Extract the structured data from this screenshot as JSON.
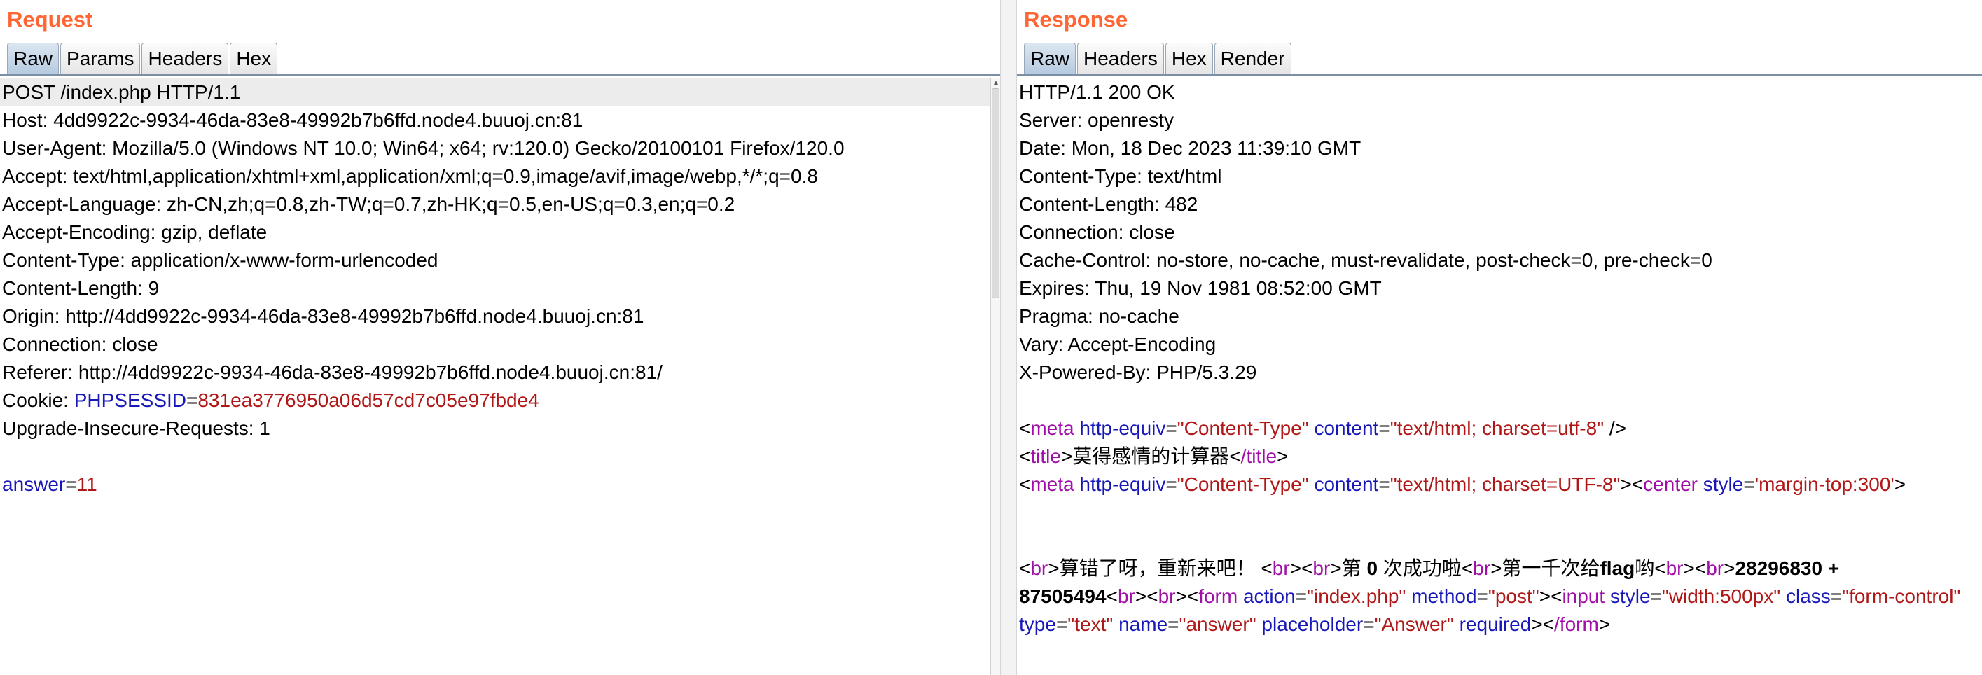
{
  "request": {
    "title": "Request",
    "tabs": [
      "Raw",
      "Params",
      "Headers",
      "Hex"
    ],
    "active_tab": "Raw",
    "lines": {
      "l1": "POST /index.php HTTP/1.1",
      "l2": "Host: 4dd9922c-9934-46da-83e8-49992b7b6ffd.node4.buuoj.cn:81",
      "l3": "User-Agent: Mozilla/5.0 (Windows NT 10.0; Win64; x64; rv:120.0) Gecko/20100101 Firefox/120.0",
      "l4": "Accept: text/html,application/xhtml+xml,application/xml;q=0.9,image/avif,image/webp,*/*;q=0.8",
      "l5": "Accept-Language: zh-CN,zh;q=0.8,zh-TW;q=0.7,zh-HK;q=0.5,en-US;q=0.3,en;q=0.2",
      "l6": "Accept-Encoding: gzip, deflate",
      "l7": "Content-Type: application/x-www-form-urlencoded",
      "l8": "Content-Length: 9",
      "l9": "Origin: http://4dd9922c-9934-46da-83e8-49992b7b6ffd.node4.buuoj.cn:81",
      "l10": "Connection: close",
      "l11": "Referer: http://4dd9922c-9934-46da-83e8-49992b7b6ffd.node4.buuoj.cn:81/",
      "l12_prefix": "Cookie: ",
      "l12_key": "PHPSESSID",
      "l12_eq": "=",
      "l12_val": "831ea3776950a06d57cd7c05e97fbde4",
      "l13": "Upgrade-Insecure-Requests: 1",
      "l15_key": "answer",
      "l15_eq": "=",
      "l15_val": "11"
    }
  },
  "response": {
    "title": "Response",
    "tabs": [
      "Raw",
      "Headers",
      "Hex",
      "Render"
    ],
    "active_tab": "Raw",
    "headers": [
      "HTTP/1.1 200 OK",
      "Server: openresty",
      "Date: Mon, 18 Dec 2023 11:39:10 GMT",
      "Content-Type: text/html",
      "Content-Length: 482",
      "Connection: close",
      "Cache-Control: no-store, no-cache, must-revalidate, post-check=0, pre-check=0",
      "Expires: Thu, 19 Nov 1981 08:52:00 GMT",
      "Pragma: no-cache",
      "Vary: Accept-Encoding",
      "X-Powered-By: PHP/5.3.29"
    ],
    "html": {
      "lt": "<",
      "gt": ">",
      "meta": "meta",
      "http_equiv_attr": "http-equiv",
      "content_type_val": "\"Content-Type\"",
      "content_attr": "content",
      "charset_utf8_lower": "\"text/html; charset=utf-8\"",
      "self_close": " />",
      "title_tag": "title",
      "title_close_tag": "/title",
      "title_text": "莫得感情的计算器",
      "charset_utf8_upper": "\"text/html; charset=UTF-8\"",
      "center_tag": "center",
      "style_attr": "style",
      "center_style_val": "'margin-top:300'",
      "br": "br",
      "msg1": "算错了呀，重新来吧！",
      "msg2a": "第 ",
      "msg2b": "0",
      "msg2c": " 次成功啦",
      "msg3a": "第一千次给",
      "msg3b": "flag",
      "msg3c": "哟",
      "expr_line1": "28296830 +",
      "expr_line2": "87505494",
      "form_tag": "form",
      "action_attr": "action",
      "action_val": "\"index.php\"",
      "method_attr": "method",
      "method_val": "\"post\"",
      "input_tag": "input",
      "input_style_val": "\"width:500px\"",
      "class_attr": "class",
      "class_val": "\"form-control\"",
      "type_attr": "type",
      "type_val": "\"text\"",
      "name_attr": "name",
      "name_val": "\"answer\"",
      "placeholder_attr": "placeholder",
      "placeholder_val": "\"Answer\"",
      "required_attr": "required",
      "form_close_tag": "/form",
      "eq": "=",
      "space": " "
    }
  }
}
